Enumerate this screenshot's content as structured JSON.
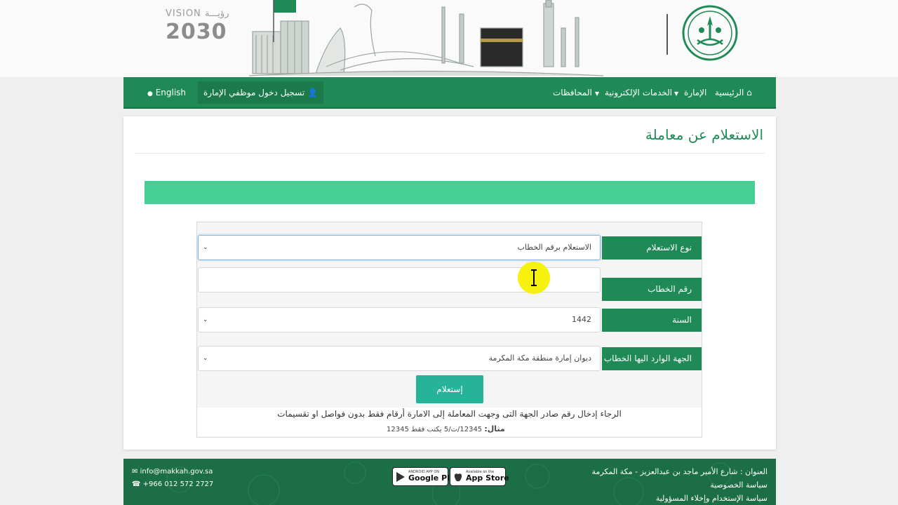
{
  "banner": {
    "vision_top": "VISION رؤيـــة",
    "vision_year": "2030"
  },
  "nav": {
    "home": "الرئيسية",
    "emirate": "الإمارة",
    "eservices": "الخدمات الإلكترونية",
    "governorates": "المحافظات",
    "login": "تسجيل دخول موظفي الإمارة",
    "language": "English"
  },
  "page": {
    "title": "الاستعلام عن معاملة"
  },
  "form": {
    "inquiry_type_label": "نوع الاستعلام",
    "inquiry_type_value": "الاستعلام برقم الخطاب",
    "letter_number_label": "رقم الخطاب",
    "letter_number_value": "",
    "year_label": "السنة",
    "year_value": "1442",
    "recipient_label": "الجهة الوارد اليها الخطاب",
    "recipient_value": "ديوان إمارة منطقة مكة المكرمة",
    "submit_label": "إستعلام",
    "help_text": "الرجاء إدخال رقم صادر الجهة التى وجهت المعاملة إلى الامارة أرقام فقط بدون فواصل او تقسيمات",
    "example_label": "مثال:",
    "example_text": "12345/ت/5 يكتب فقط 12345"
  },
  "footer": {
    "address": "العنوان : شارع الأمير ماجد بن عبدالعزيز - مكة المكرمة",
    "privacy": "سياسة الخصوصية",
    "terms": "سياسة الإستخدام وإخلاء المسؤولية",
    "email": "info@makkah.gov.sa",
    "phone": "+966 012 572 2727",
    "google_small": "ANDROID APP ON",
    "google_big": "Google Play",
    "apple_small": "Available on the",
    "apple_big": "App Store"
  },
  "colors": {
    "primary_green": "#1f8a55",
    "alert_green": "#45cf95",
    "button_teal": "#26b39a",
    "footer_green": "#1b6e45"
  }
}
